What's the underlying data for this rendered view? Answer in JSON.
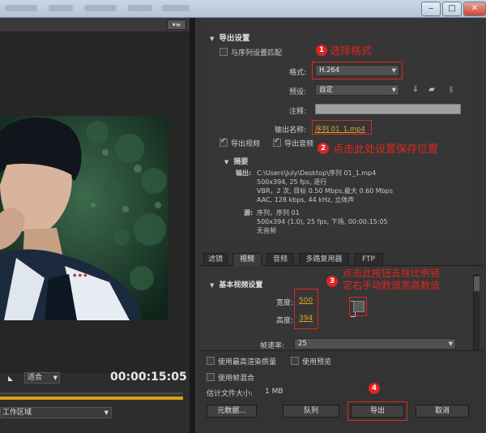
{
  "window": {
    "close_label": "✕",
    "min_label": "‒",
    "max_label": "□"
  },
  "left_panel": {
    "menu_icon_label": "▾≡",
    "fit_label": "适合",
    "timecode": "00:00:15:05",
    "source_range": "工作区域"
  },
  "export_settings": {
    "section_title": "导出设置",
    "match_sequence_label": "与序列设置匹配",
    "format_label": "格式:",
    "format_value": "H.264",
    "preset_label": "预设:",
    "preset_value": "自定",
    "comment_label": "注释:",
    "comment_value": "",
    "output_name_label": "输出名称:",
    "output_name_value": "序列 01_1.mp4",
    "export_video_label": "导出视频",
    "export_video_checked": true,
    "export_audio_label": "导出音频",
    "export_audio_checked": true,
    "summary_title": "摘要",
    "summary_output_label": "输出:",
    "summary_output_lines": [
      "C:\\Users\\July\\Desktop\\序列 01_1.mp4",
      "500x394, 25 fps, 逐行",
      "VBR，2 次, 目标 0.50 Mbps,最大 0.60 Mbps",
      "AAC, 128 kbps, 44 kHz, 立体声"
    ],
    "summary_source_label": "源:",
    "summary_source_lines": [
      "序列，序列 01",
      "500x394 (1.0), 25 fps, 下场, 00:00:15:05",
      "无音频"
    ]
  },
  "tabs": [
    "滤镜",
    "视频",
    "音频",
    "多路复用器",
    "FTP"
  ],
  "active_tab": "视频",
  "basic_video": {
    "section_title": "基本视频设置",
    "width_label": "宽度:",
    "width_value": "500",
    "height_label": "高度:",
    "height_value": "394",
    "fps_label": "帧速率:",
    "fps_value": "25"
  },
  "bottom": {
    "max_render_label": "使用最高渲染质量",
    "use_preview_label": "使用预览",
    "frame_blend_label": "使用帧混合",
    "file_size_label": "估计文件大小:",
    "file_size_value": "1 MB",
    "metadata_button": "元数据...",
    "queue_button": "队列",
    "export_button": "导出",
    "cancel_button": "取消"
  },
  "annotations": {
    "a1_num": "1",
    "a1_text": "选择格式",
    "a2_num": "2",
    "a2_text": "点击此处设置保存位置",
    "a3_num": "3",
    "a3_line1": "点击此按钮去除比例锁",
    "a3_line2": "定右手动数值宽高数值",
    "a4_num": "4"
  },
  "colors": {
    "accent_orange": "#e3a22a",
    "annotation_red": "#e0261e",
    "timeline": "#d9a11a"
  }
}
